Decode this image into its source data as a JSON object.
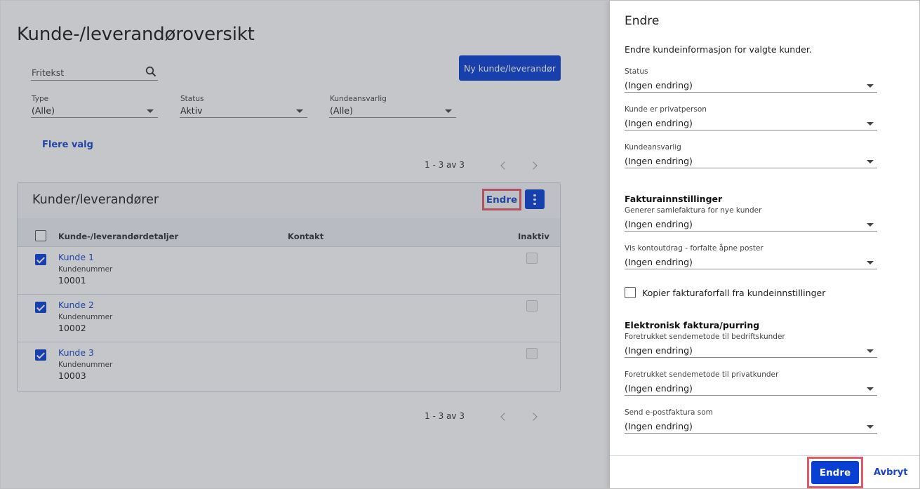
{
  "page": {
    "title": "Kunde-/leverandøroversikt"
  },
  "search": {
    "placeholder": "Fritekst",
    "icon": "search-icon"
  },
  "toolbar": {
    "new_label": "Ny kunde/leverandør"
  },
  "filters": {
    "type": {
      "label": "Type",
      "value": "(Alle)"
    },
    "status": {
      "label": "Status",
      "value": "Aktiv"
    },
    "responsible": {
      "label": "Kundeansvarlig",
      "value": "(Alle)"
    },
    "more_label": "Flere valg"
  },
  "pager": {
    "text": "1 - 3 av 3"
  },
  "card": {
    "title": "Kunder/leverandører",
    "edit_label": "Endre",
    "columns": [
      "Kunde-/leverandørdetaljer",
      "Kontakt",
      "Inaktiv"
    ],
    "rows": [
      {
        "name": "Kunde 1",
        "sub_label": "Kundenummer",
        "number": "10001",
        "checked": true
      },
      {
        "name": "Kunde 2",
        "sub_label": "Kundenummer",
        "number": "10002",
        "checked": true
      },
      {
        "name": "Kunde 3",
        "sub_label": "Kundenummer",
        "number": "10003",
        "checked": true
      }
    ]
  },
  "panel": {
    "title": "Endre",
    "description": "Endre kundeinformasjon for valgte kunder.",
    "fields": [
      {
        "label": "Status",
        "value": "(Ingen endring)"
      },
      {
        "label": "Kunde er privatperson",
        "value": "(Ingen endring)"
      },
      {
        "label": "Kundeansvarlig",
        "value": "(Ingen endring)"
      }
    ],
    "invoice_section": {
      "title": "Fakturainnstillinger",
      "fields": [
        {
          "label": "Generer samlefaktura for nye kunder",
          "value": "(Ingen endring)"
        },
        {
          "label": "Vis kontoutdrag - forfalte åpne poster",
          "value": "(Ingen endring)"
        }
      ],
      "checkbox_label": "Kopier fakturaforfall fra kundeinnstillinger"
    },
    "einvoice_section": {
      "title": "Elektronisk faktura/purring",
      "fields": [
        {
          "label": "Foretrukket sendemetode til bedriftskunder",
          "value": "(Ingen endring)"
        },
        {
          "label": "Foretrukket sendemetode til privatkunder",
          "value": "(Ingen endring)"
        },
        {
          "label": "Send e-postfaktura som",
          "value": "(Ingen endring)"
        }
      ]
    },
    "footer": {
      "submit_label": "Endre",
      "cancel_label": "Avbryt"
    }
  },
  "colors": {
    "primary": "#0a3fd4",
    "link": "#1a45c9",
    "highlight": "#e25b66"
  }
}
